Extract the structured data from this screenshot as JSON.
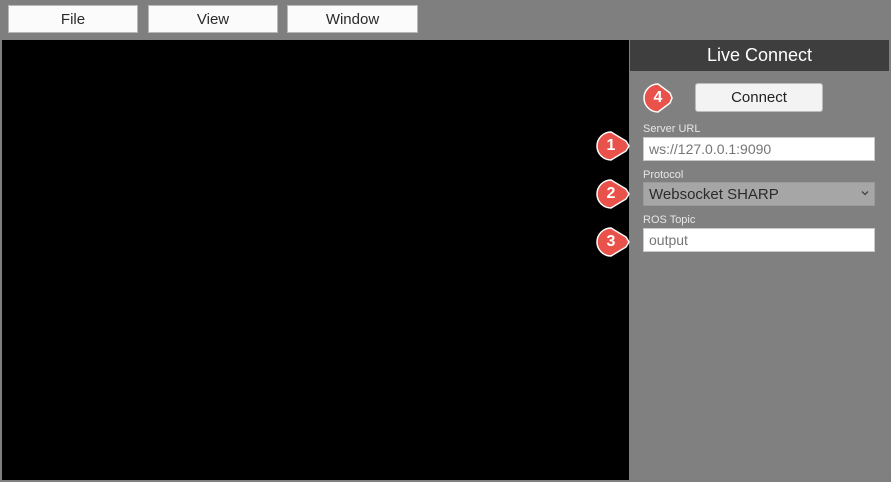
{
  "menu": {
    "file": "File",
    "view": "View",
    "window": "Window"
  },
  "panel": {
    "title": "Live Connect",
    "connect_label": "Connect",
    "server_url": {
      "label": "Server URL",
      "placeholder": "ws://127.0.0.1:9090"
    },
    "protocol": {
      "label": "Protocol",
      "selected": "Websocket SHARP"
    },
    "ros_topic": {
      "label": "ROS Topic",
      "placeholder": "output"
    }
  },
  "callouts": {
    "c1": "1",
    "c2": "2",
    "c3": "3",
    "c4": "4"
  },
  "colors": {
    "callout": "#e9514b",
    "panel_header": "#3e3e3e",
    "panel_bg": "#808080",
    "viewport_bg": "#000000"
  }
}
